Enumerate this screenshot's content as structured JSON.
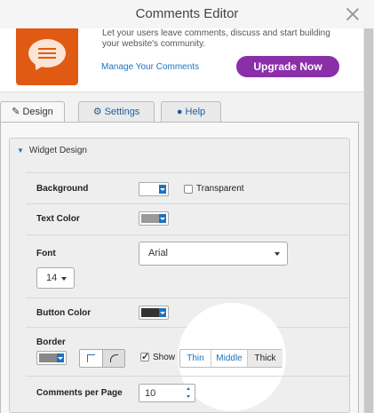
{
  "window": {
    "title": "Comments Editor"
  },
  "promo": {
    "description": "Let your users leave comments, discuss and start building your website's community.",
    "manage_link": "Manage Your Comments",
    "upgrade_label": "Upgrade Now"
  },
  "tabs": [
    {
      "label": "Design",
      "icon": "paintbrush-icon",
      "active": true
    },
    {
      "label": "Settings",
      "icon": "gear-icon",
      "active": false
    },
    {
      "label": "Help",
      "icon": "user-icon",
      "active": false
    }
  ],
  "section": {
    "title": "Widget Design"
  },
  "fields": {
    "background": {
      "label": "Background",
      "color": "#ffffff",
      "transparent_label": "Transparent",
      "transparent": false
    },
    "text_color": {
      "label": "Text Color",
      "color": "#999999"
    },
    "font": {
      "label": "Font",
      "family": "Arial",
      "size": "14"
    },
    "button_color": {
      "label": "Button Color",
      "color": "#333333"
    },
    "border": {
      "label": "Border",
      "color": "#888888",
      "show_label": "Show",
      "show": true,
      "thickness_options": [
        "Thin",
        "Middle",
        "Thick"
      ],
      "thickness_selected": "Thick"
    },
    "comments_per_page": {
      "label": "Comments per Page",
      "value": "10"
    }
  },
  "colors": {
    "accent": "#1e73be",
    "upgrade": "#8a2fa8",
    "app_icon": "#e05a14"
  }
}
